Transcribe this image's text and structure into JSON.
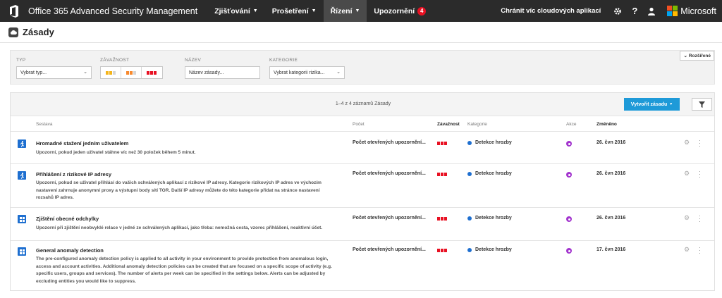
{
  "topbar": {
    "app_title": "Office 365 Advanced Security Management",
    "nav": [
      {
        "label": "Zjišťování",
        "caret": "▼"
      },
      {
        "label": "Prošetření",
        "caret": "▼"
      },
      {
        "label": "Řízení",
        "caret": "▼"
      },
      {
        "label": "Upozornění",
        "badge": "4"
      }
    ],
    "connect_link": "Chránit víc cloudových aplikací",
    "brand": "Microsoft",
    "colors": {
      "bg": "#2b2b2b",
      "active": "#4a4a4a",
      "badge": "#e81123"
    },
    "icons": [
      "gear-icon",
      "help-icon",
      "user-icon"
    ]
  },
  "page": {
    "title": "Zásady",
    "icon": "cloud-icon"
  },
  "filters": {
    "type_label": "TYP",
    "type_value": "Vybrat typ...",
    "severity_label": "ZÁVAŽNOST",
    "name_label": "NÁZEV",
    "name_value": "Název zásady...",
    "category_label": "KATEGORIE",
    "category_value": "Vybrat kategorii rizika...",
    "advanced_label": "Rozšířené",
    "severity_colors": {
      "low": "#f4b41a",
      "medium": "#f7892d",
      "high": "#e81123"
    }
  },
  "table": {
    "count_text": "1–4 z 4 záznamů Zásady",
    "create_button": "Vytvořit zásadu",
    "create_caret": "▼",
    "headers": {
      "report": "Sestava",
      "count": "Počet",
      "severity": "Závažnost",
      "category": "Kategorie",
      "action": "Akce",
      "modified": "Změněno"
    },
    "rows": [
      {
        "title": "Hromadné stažení jedním uživatelem",
        "desc": "Upozorní, pokud jeden uživatel stáhne víc než 30 položek během 5 minut.",
        "count": "Počet otevřených upozornění...",
        "category": "Detekce hrozby",
        "date": "26. čvn 2016",
        "icon": "running-person-icon"
      },
      {
        "title": "Přihlášení z rizikové IP adresy",
        "desc": "Upozorní, pokud se uživatel přihlásí do vašich schválených aplikací z rizikové IP adresy. Kategorie rizikových IP adres ve výchozím nastavení zahrnuje anonymní proxy a výstupní body sítí TOR. Další IP adresy můžete do této kategorie přidat na stránce nastavení rozsahů IP adres.",
        "count": "Počet otevřených upozornění...",
        "category": "Detekce hrozby",
        "date": "26. čvn 2016",
        "icon": "running-person-icon"
      },
      {
        "title": "Zjištění obecné odchylky",
        "desc": "Upozorní při zjištění neobvyklé relace v jedné ze schválených aplikací, jako třeba: nemožná cesta, vzorec přihlášení, neaktivní účet.",
        "count": "Počet otevřených upozornění...",
        "category": "Detekce hrozby",
        "date": "26. čvn 2016",
        "icon": "grid-icon"
      },
      {
        "title": "General anomaly detection",
        "desc": "The pre-configured anomaly detection policy is applied to all activity in your environment to provide protection from anomalous login, access and account activities. Additional anomaly detection policies can be created that are focused on a specific scope of activity (e.g. specific users, groups and services). The number of alerts per week can be specified in the settings below. Alerts can be adjusted by excluding entities you would like to suppress.",
        "count": "Počet otevřených upozornění...",
        "category": "Detekce hrozby",
        "date": "17. čvn 2016",
        "icon": "grid-icon"
      }
    ]
  }
}
